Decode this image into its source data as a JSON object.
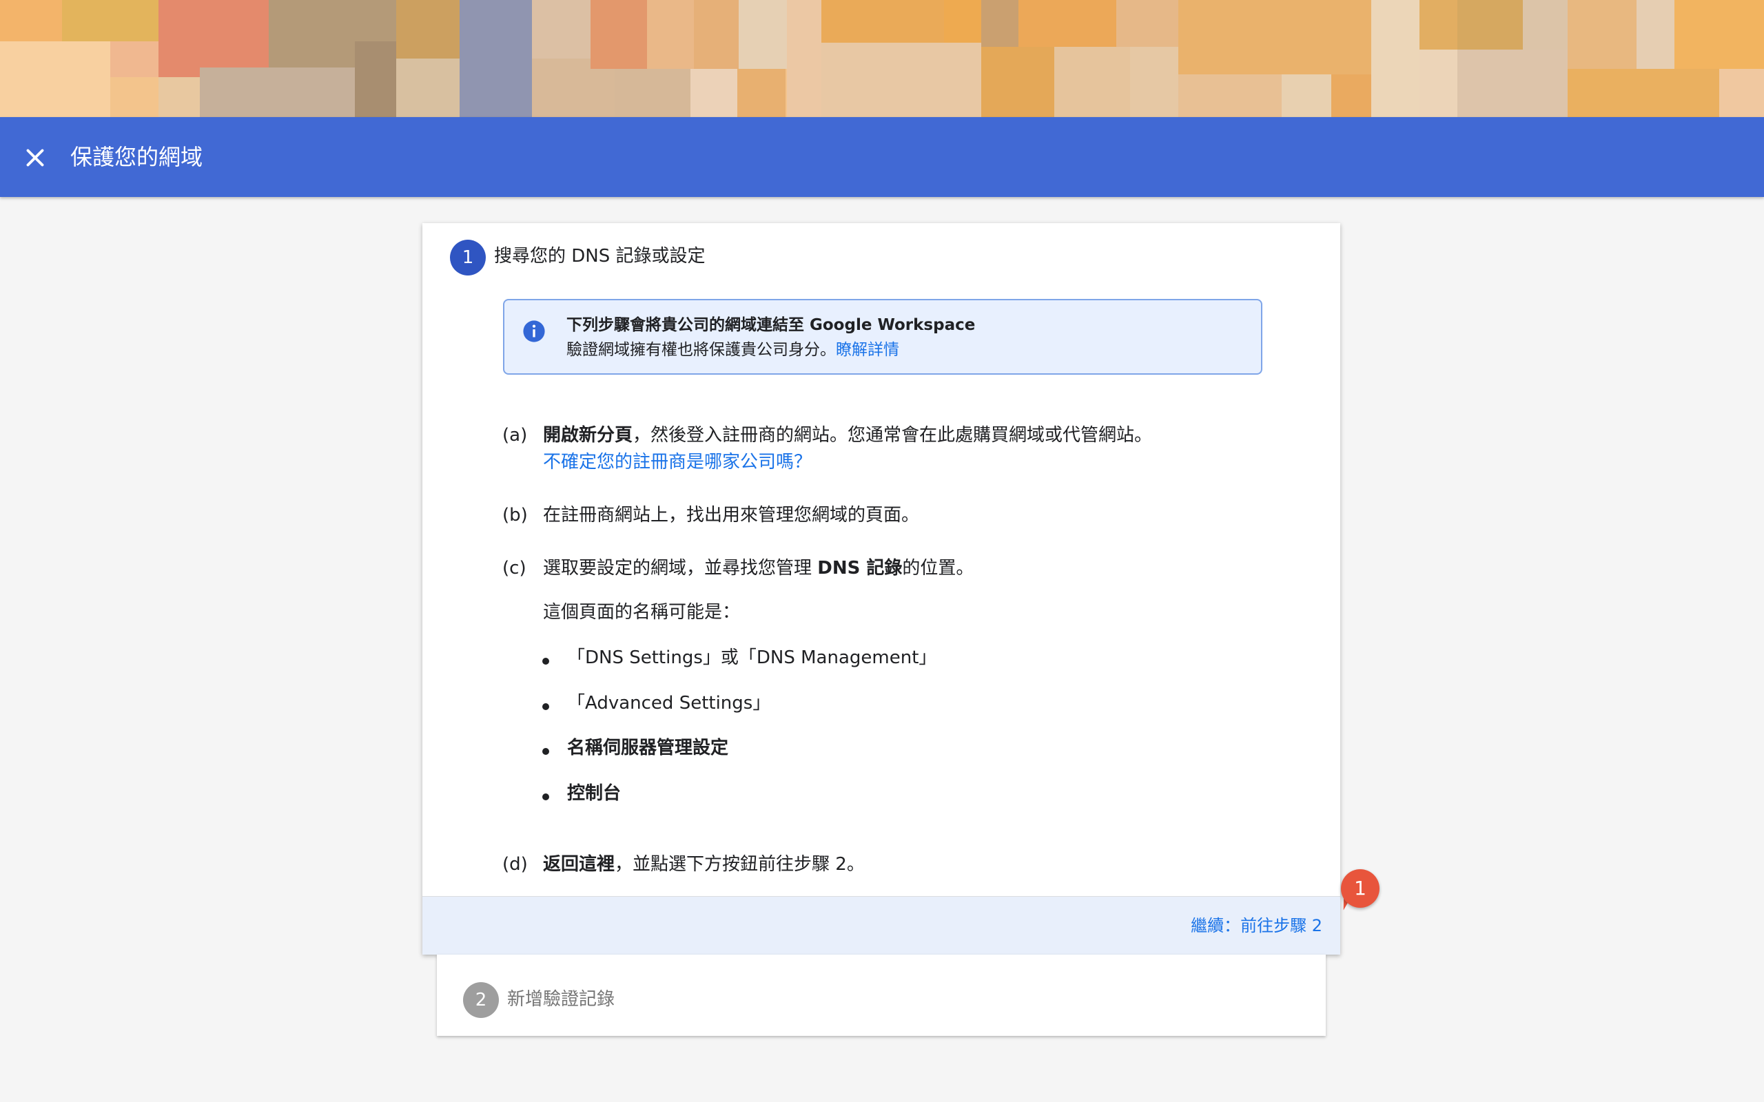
{
  "header": {
    "title": "保護您的網域",
    "close_icon": "close-icon"
  },
  "colors": {
    "header_bg": "#4169d4",
    "step_active": "#2f55c2",
    "step_inactive": "#9e9e9e",
    "link": "#1a73e8",
    "badge": "#e8553c"
  },
  "step1": {
    "number": "1",
    "title": "搜尋您的 DNS 記錄或設定",
    "info": {
      "title": "下列步驟會將貴公司的網域連結至 Google Workspace",
      "body": "驗證網域擁有權也將保護貴公司身分。",
      "link": "瞭解詳情"
    },
    "items": {
      "a": {
        "marker": "(a)",
        "bold": "開啟新分頁",
        "text": "，然後登入註冊商的網站。您通常會在此處購買網域或代管網站。",
        "link": "不確定您的註冊商是哪家公司嗎？"
      },
      "b": {
        "marker": "(b)",
        "text": "在註冊商網站上，找出用來管理您網域的頁面。"
      },
      "c": {
        "marker": "(c)",
        "pre": "選取要設定的網域，並尋找您管理 ",
        "bold": "DNS 記錄",
        "post": "的位置。",
        "subtitle": "這個頁面的名稱可能是：",
        "bullets": [
          "「DNS Settings」或「DNS Management」",
          "「Advanced Settings」",
          "名稱伺服器管理設定",
          "控制台"
        ]
      },
      "d": {
        "marker": "(d)",
        "bold": "返回這裡",
        "text": "，並點選下方按鈕前往步驟 2。"
      }
    },
    "continue_label": "繼續：前往步驟 2"
  },
  "badge": {
    "count": "1"
  },
  "step2": {
    "number": "2",
    "title": "新增驗證記錄"
  }
}
